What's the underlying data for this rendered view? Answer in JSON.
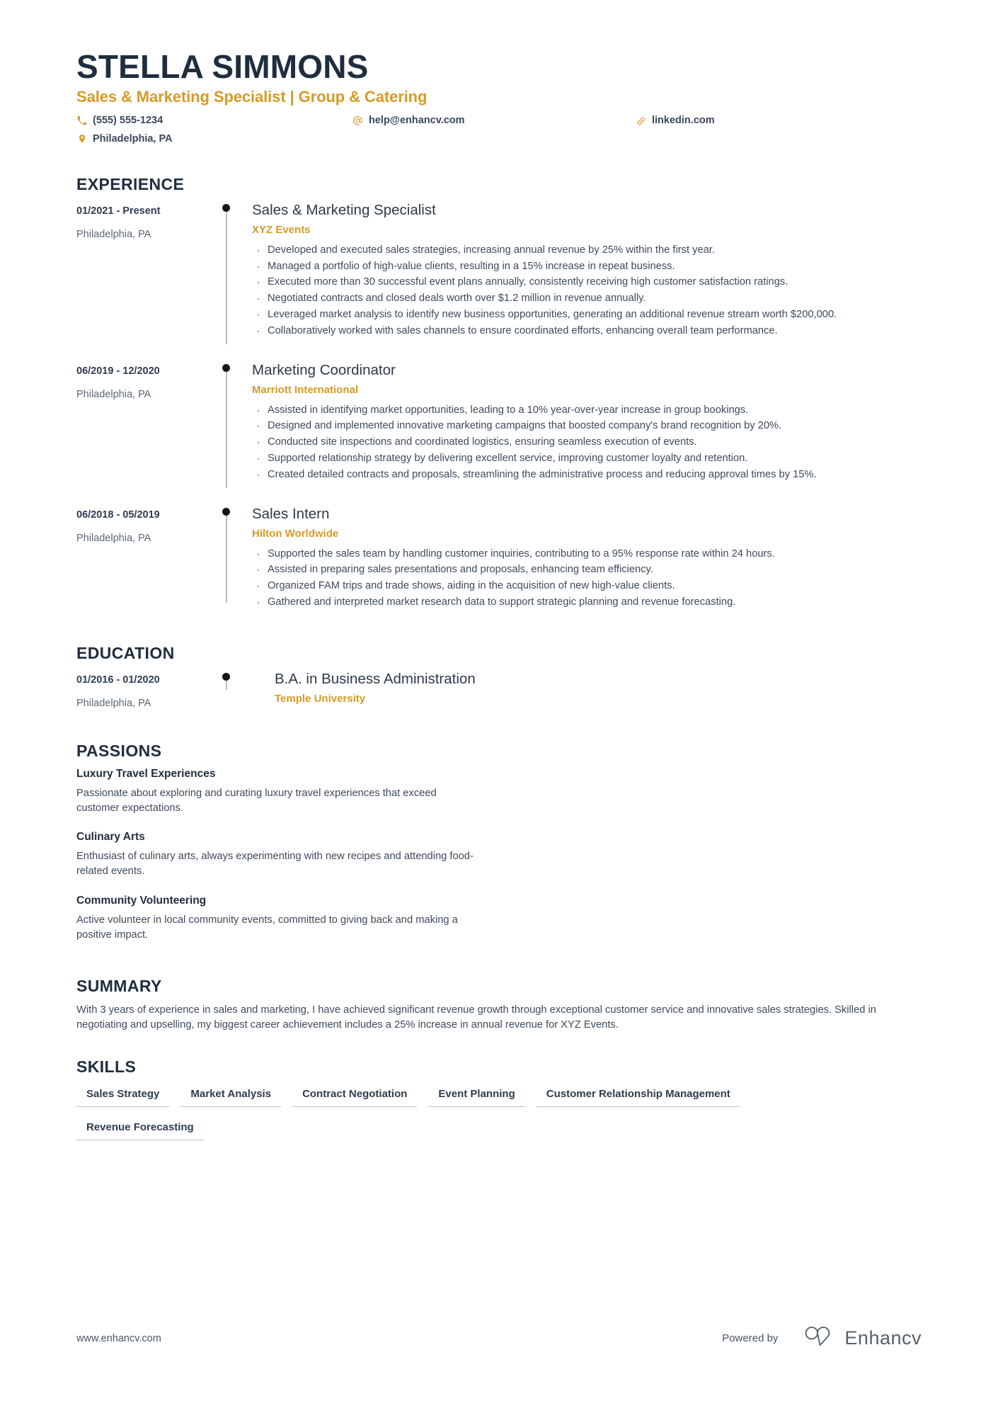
{
  "header": {
    "name": "STELLA SIMMONS",
    "headline": "Sales & Marketing Specialist | Group & Catering",
    "contacts": [
      {
        "icon": "phone-icon",
        "text": "(555) 555-1234"
      },
      {
        "icon": "location-pin-icon",
        "text": "Philadelphia, PA"
      },
      {
        "icon": "email-at-icon",
        "text": "help@enhancv.com"
      },
      {
        "icon": "link-icon",
        "text": "linkedin.com"
      }
    ]
  },
  "colors": {
    "accent": "#d79a26",
    "heading": "#1f2d3f",
    "body": "#3d4a5a",
    "rail": "#b9bec6"
  },
  "sections": {
    "experience": {
      "title": "EXPERIENCE",
      "entries": [
        {
          "date": "01/2021 - Present",
          "location": "Philadelphia, PA",
          "title": "Sales & Marketing Specialist",
          "organization": "XYZ Events",
          "bullets": [
            "Developed and executed sales strategies, increasing annual revenue by 25% within the first year.",
            "Managed a portfolio of high-value clients, resulting in a 15% increase in repeat business.",
            "Executed more than 30 successful event plans annually, consistently receiving high customer satisfaction ratings.",
            "Negotiated contracts and closed deals worth over $1.2 million in revenue annually.",
            "Leveraged market analysis to identify new business opportunities, generating an additional revenue stream worth $200,000.",
            "Collaboratively worked with sales channels to ensure coordinated efforts, enhancing overall team performance."
          ]
        },
        {
          "date": "06/2019 - 12/2020",
          "location": "Philadelphia, PA",
          "title": "Marketing Coordinator",
          "organization": "Marriott International",
          "bullets": [
            "Assisted in identifying market opportunities, leading to a 10% year-over-year increase in group bookings.",
            "Designed and implemented innovative marketing campaigns that boosted company's brand recognition by 20%.",
            "Conducted site inspections and coordinated logistics, ensuring seamless execution of events.",
            "Supported relationship strategy by delivering excellent service, improving customer loyalty and retention.",
            "Created detailed contracts and proposals, streamlining the administrative process and reducing approval times by 15%."
          ]
        },
        {
          "date": "06/2018 - 05/2019",
          "location": "Philadelphia, PA",
          "title": "Sales Intern",
          "organization": "Hilton Worldwide",
          "bullets": [
            "Supported the sales team by handling customer inquiries, contributing to a 95% response rate within 24 hours.",
            "Assisted in preparing sales presentations and proposals, enhancing team efficiency.",
            "Organized FAM trips and trade shows, aiding in the acquisition of new high-value clients.",
            "Gathered and interpreted market research data to support strategic planning and revenue forecasting."
          ]
        }
      ]
    },
    "education": {
      "title": "EDUCATION",
      "entries": [
        {
          "date": "01/2016 - 01/2020",
          "location": "Philadelphia, PA",
          "title": "B.A. in Business Administration",
          "organization": "Temple University",
          "bullets": []
        }
      ]
    },
    "passions": {
      "title": "PASSIONS",
      "items": [
        {
          "title": "Luxury Travel Experiences",
          "description": "Passionate about exploring and curating luxury travel experiences that exceed customer expectations."
        },
        {
          "title": "Culinary Arts",
          "description": "Enthusiast of culinary arts, always experimenting with new recipes and attending food-related events."
        },
        {
          "title": "Community Volunteering",
          "description": "Active volunteer in local community events, committed to giving back and making a positive impact."
        }
      ]
    },
    "summary": {
      "title": "SUMMARY",
      "text": "With 3 years of experience in sales and marketing, I have achieved significant revenue growth through exceptional customer service and innovative sales strategies. Skilled in negotiating and upselling, my biggest career achievement includes a 25% increase in annual revenue for XYZ Events."
    },
    "skills": {
      "title": "SKILLS",
      "items": [
        "Sales Strategy",
        "Market Analysis",
        "Contract Negotiation",
        "Event Planning",
        "Customer Relationship Management",
        "Revenue Forecasting"
      ]
    }
  },
  "footer": {
    "url": "www.enhancv.com",
    "powered_by": "Powered by",
    "brand": "Enhancv"
  }
}
